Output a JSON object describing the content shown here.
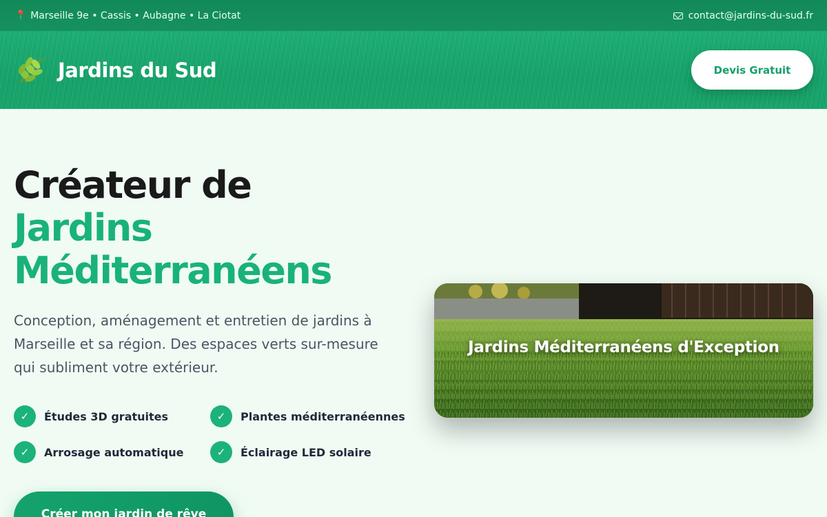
{
  "topbar": {
    "locations_icon": "pin-icon",
    "locations": "Marseille 9e • Cassis • Aubagne • La Ciotat",
    "email_icon": "mail-icon",
    "email": "contact@jardins-du-sud.fr"
  },
  "header": {
    "logo_icon": "leaf-icon",
    "brand": "Jardins du Sud",
    "cta": "Devis Gratuit"
  },
  "hero": {
    "title_line1": "Créateur de",
    "title_line2": "Jardins",
    "title_line3": "Méditerranéens",
    "description": "Conception, aménagement et entretien de jardins à Marseille et sa région. Des espaces verts sur-mesure qui subliment votre extérieur.",
    "features": [
      "Études 3D gratuites",
      "Plantes méditerranéennes",
      "Arrosage automatique",
      "Éclairage LED solaire"
    ],
    "cta": "Créer mon jardin de rêve",
    "card_caption": "Jardins Méditerranéens d'Exception"
  },
  "colors": {
    "brand_green": "#19b27a",
    "topbar_green": "#128a58",
    "header_green": "#1dae74",
    "background": "#f0fbf4",
    "heading_dark": "#1a1a1a"
  }
}
